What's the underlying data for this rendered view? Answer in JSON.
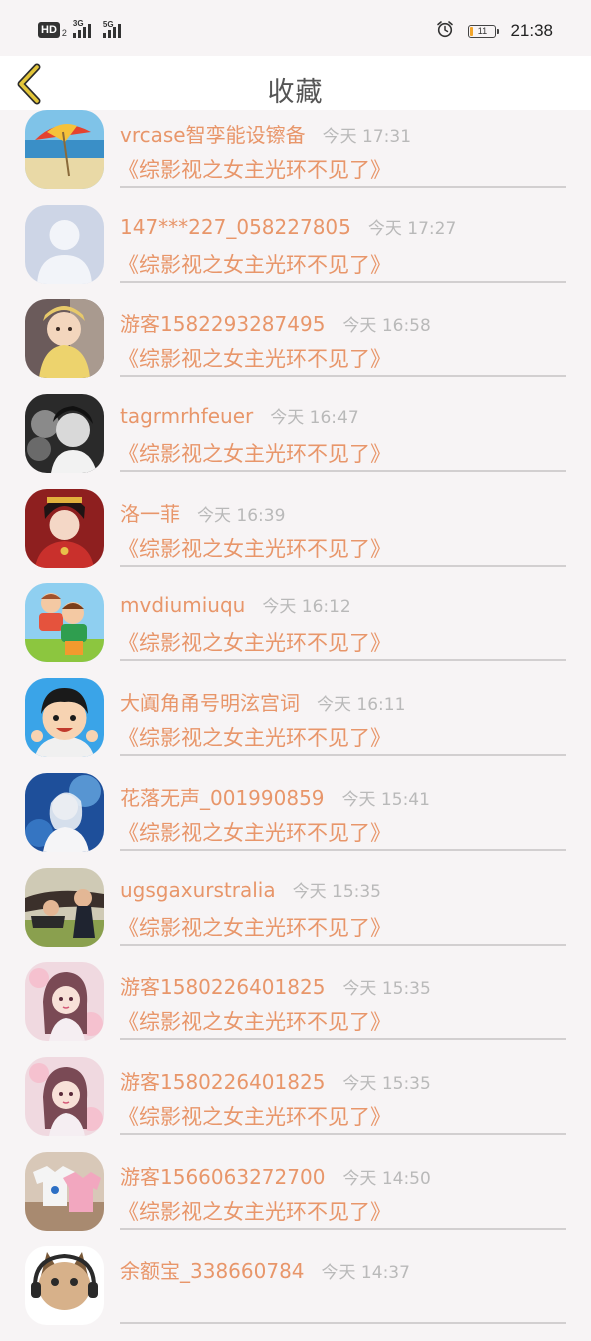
{
  "status_bar": {
    "hd_label": "HD",
    "sim_index": "2",
    "net1": "3G",
    "net2": "5G",
    "battery_level": "11",
    "battery_fraction": 0.11,
    "time": "21:38",
    "icons": [
      "alarm-icon",
      "battery-icon",
      "signal-icon"
    ]
  },
  "nav": {
    "title": "收藏",
    "back_icon": "chevron-left-icon",
    "accent": "#e2c53a"
  },
  "colors": {
    "name": "#e8966a",
    "time": "#b9b9b9",
    "divider": "#d2cfd0",
    "background": "#f7f4f5"
  },
  "favorites": [
    {
      "name": "vrcase智孪能设镲备",
      "time": "今天 17:31",
      "title": "《综影视之女主光环不见了》",
      "avatar": "beach-umbrella-avatar"
    },
    {
      "name": "147***227_058227805",
      "time": "今天 17:27",
      "title": "《综影视之女主光环不见了》",
      "avatar": "default-user-avatar"
    },
    {
      "name": "游客1582293287495",
      "time": "今天 16:58",
      "title": "《综影视之女主光环不见了》",
      "avatar": "baby-photo-avatar"
    },
    {
      "name": "tagrmrhfeuer",
      "time": "今天 16:47",
      "title": "《综影视之女主光环不见了》",
      "avatar": "monochrome-portrait-avatar"
    },
    {
      "name": "洛一菲",
      "time": "今天 16:39",
      "title": "《综影视之女主光环不见了》",
      "avatar": "costume-portrait-avatar"
    },
    {
      "name": "mvdiumiuqu",
      "time": "今天 16:12",
      "title": "《综影视之女主光环不见了》",
      "avatar": "cartoon-kids-avatar"
    },
    {
      "name": "大阗角甬号明泫宫词",
      "time": "今天 16:11",
      "title": "《综影视之女主光环不见了》",
      "avatar": "cartoon-boy-avatar"
    },
    {
      "name": "花落无声_001990859",
      "time": "今天 15:41",
      "title": "《综影视之女主光环不见了》",
      "avatar": "blue-fantasy-avatar"
    },
    {
      "name": "ugsgaxurstralia",
      "time": "今天 15:35",
      "title": "《综影视之女主光环不见了》",
      "avatar": "couple-photo-avatar"
    },
    {
      "name": "游客1580226401825",
      "time": "今天 15:35",
      "title": "《综影视之女主光环不见了》",
      "avatar": "anime-girl-avatar"
    },
    {
      "name": "游客1580226401825",
      "time": "今天 15:35",
      "title": "《综影视之女主光环不见了》",
      "avatar": "anime-girl-avatar"
    },
    {
      "name": "游客1566063272700",
      "time": "今天 14:50",
      "title": "《综影视之女主光环不见了》",
      "avatar": "shirts-photo-avatar"
    },
    {
      "name": "余额宝_338660784",
      "time": "今天 14:37",
      "title": "",
      "avatar": "cat-headphones-avatar"
    }
  ]
}
